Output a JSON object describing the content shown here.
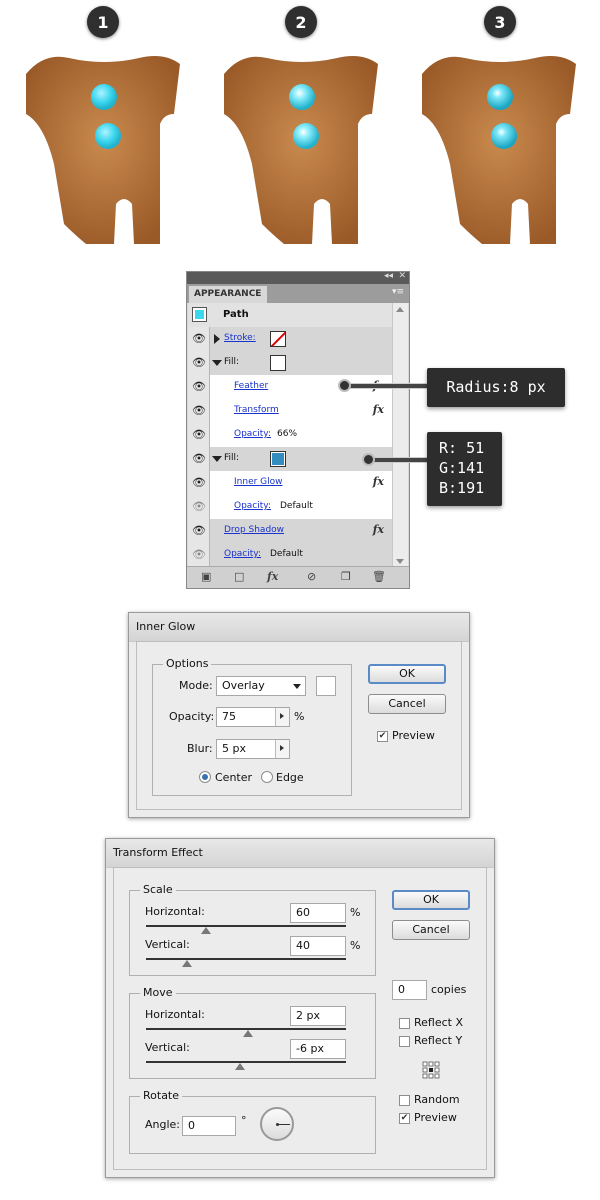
{
  "steps": [
    {
      "number": "1"
    },
    {
      "number": "2"
    },
    {
      "number": "3"
    }
  ],
  "appearance": {
    "tab_label": "APPEARANCE",
    "collapse_glyph": "◂◂",
    "close_glyph": "✕",
    "menu_glyph": "▾≡",
    "path_label": "Path",
    "rows": [
      {
        "kind": "stroke",
        "label": "Stroke:"
      },
      {
        "kind": "fill",
        "label": "Fill:"
      },
      {
        "kind": "effect",
        "label": "Feather",
        "fx": "fx"
      },
      {
        "kind": "effect",
        "label": "Transform",
        "fx": "fx"
      },
      {
        "kind": "opacity",
        "label": "Opacity:",
        "value": "66%"
      },
      {
        "kind": "fill",
        "label": "Fill:"
      },
      {
        "kind": "effect",
        "label": "Inner Glow",
        "fx": "fx"
      },
      {
        "kind": "opacity",
        "label": "Opacity:",
        "value": "Default"
      },
      {
        "kind": "effect-top",
        "label": "Drop Shadow",
        "fx": "fx"
      },
      {
        "kind": "opacity-top",
        "label": "Opacity:",
        "value": "Default"
      }
    ],
    "bottom_fx": "fx"
  },
  "callouts": {
    "radius": "Radius:8 px",
    "rgb": [
      "R: 51",
      "G:141",
      "B:191"
    ]
  },
  "inner_glow": {
    "title": "Inner Glow",
    "group_title": "Options",
    "mode_label": "Mode:",
    "mode_value": "Overlay",
    "opacity_label": "Opacity:",
    "opacity_value": "75",
    "opacity_unit": "%",
    "blur_label": "Blur:",
    "blur_value": "5 px",
    "center_label": "Center",
    "edge_label": "Edge",
    "ok_label": "OK",
    "cancel_label": "Cancel",
    "preview_label": "Preview",
    "preview_checked": true
  },
  "transform": {
    "title": "Transform Effect",
    "scale_title": "Scale",
    "scale_h_label": "Horizontal:",
    "scale_h_value": "60",
    "scale_h_unit": "%",
    "scale_v_label": "Vertical:",
    "scale_v_value": "40",
    "scale_v_unit": "%",
    "move_title": "Move",
    "move_h_label": "Horizontal:",
    "move_h_value": "2 px",
    "move_v_label": "Vertical:",
    "move_v_value": "-6 px",
    "rotate_title": "Rotate",
    "angle_label": "Angle:",
    "angle_value": "0",
    "angle_unit": "°",
    "ok_label": "OK",
    "cancel_label": "Cancel",
    "copies_value": "0",
    "copies_label": "copies",
    "reflect_x_label": "Reflect X",
    "reflect_y_label": "Reflect Y",
    "random_label": "Random",
    "preview_label": "Preview",
    "preview_checked": true
  },
  "colors": {
    "button_cyan": "#3cd6ef",
    "fill_blue": "#338dbf",
    "cookie": "#b8733a",
    "link": "#1a33cc"
  },
  "icons": {
    "visibility": "eye-icon",
    "fx": "fx-icon",
    "delete": "trash-icon"
  }
}
